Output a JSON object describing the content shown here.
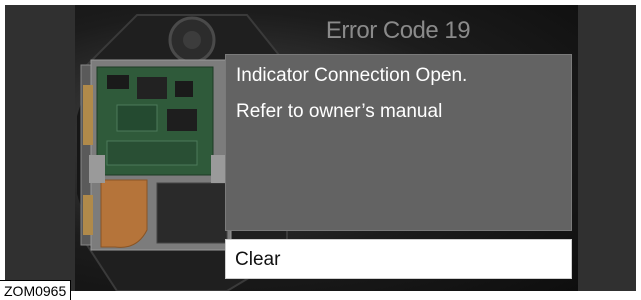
{
  "screen": {
    "title": "Error Code 19",
    "message": {
      "line1": "Indicator Connection Open.",
      "line2": "Refer to owner’s manual"
    },
    "clear_button_label": "Clear"
  },
  "figure_reference": "ZOM0965",
  "colors": {
    "screen_background": "#2a2a2a",
    "title_text": "#8a8a8a",
    "message_panel": "#636363",
    "message_text": "#ffffff",
    "button_background": "#ffffff",
    "button_text": "#111111"
  },
  "icons": {
    "background_image": "control-module-circuit-board-icon"
  }
}
